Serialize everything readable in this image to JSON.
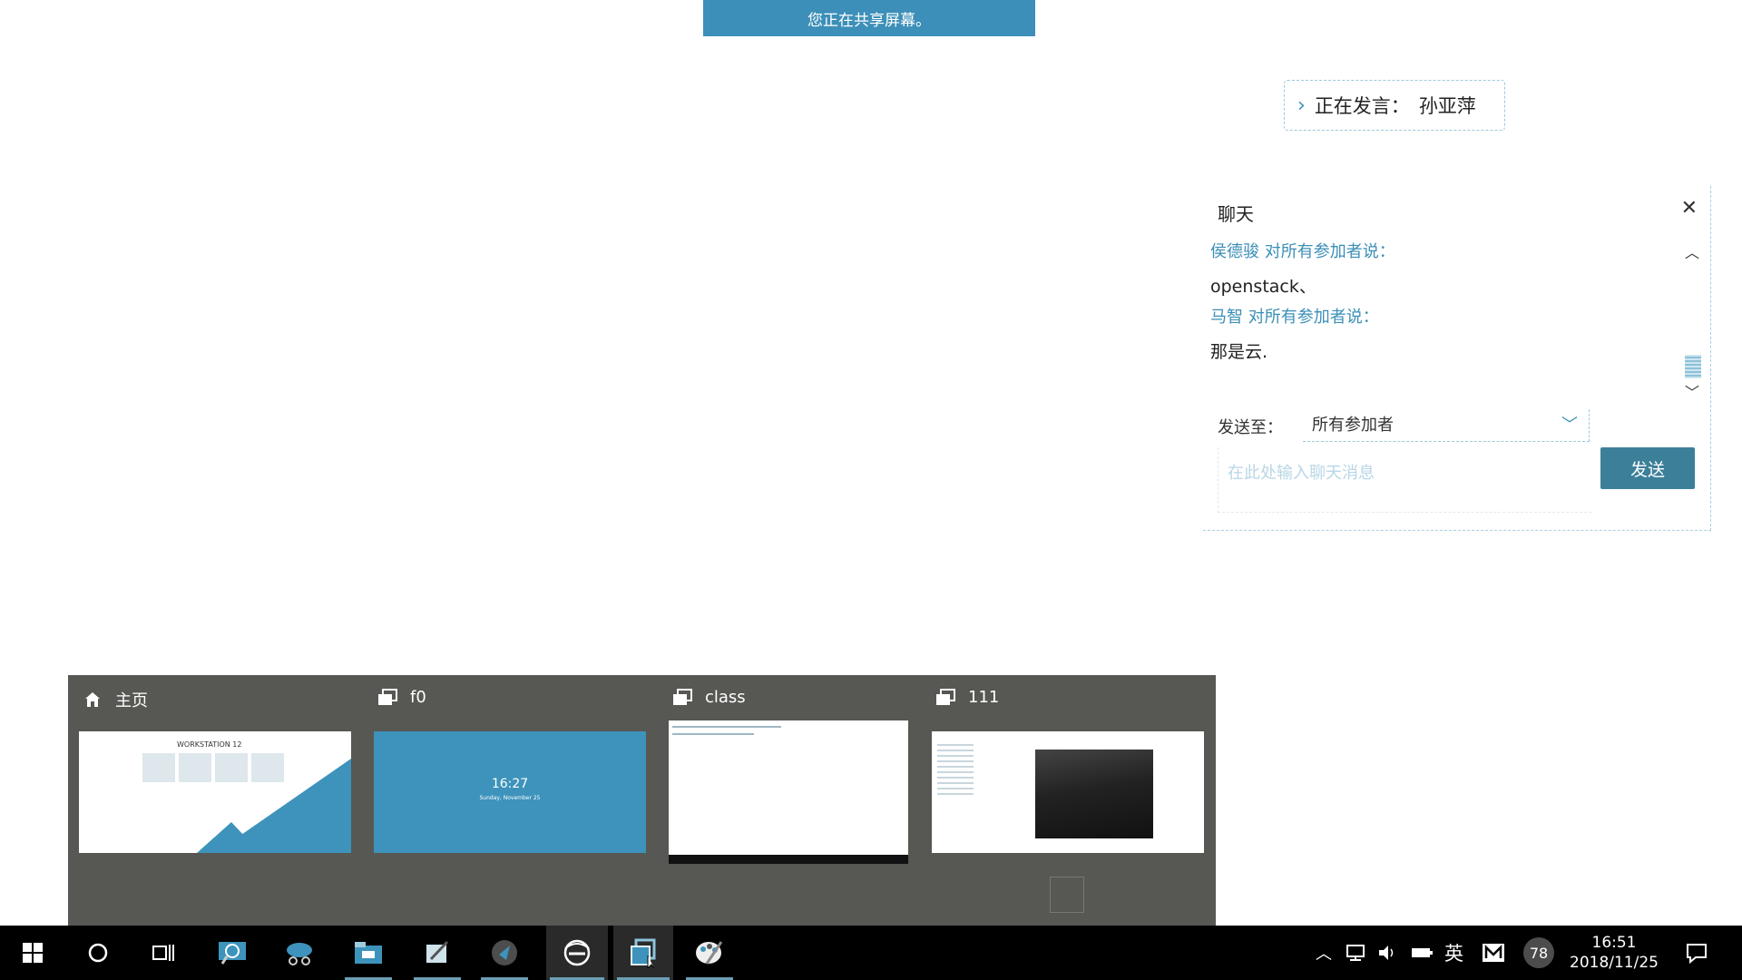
{
  "banner": {
    "text": "您正在共享屏幕。"
  },
  "speaking": {
    "label": "正在发言：",
    "name": "孙亚萍"
  },
  "chat": {
    "title": "聊天",
    "messages": [
      {
        "sender": "侯德骏 对所有参加者说：",
        "text": "openstack、"
      },
      {
        "sender": "马智 对所有参加者说：",
        "text": "那是云."
      }
    ],
    "send_to_label": "发送至：",
    "send_to_value": "所有参加者",
    "input_placeholder": "在此处输入聊天消息",
    "send_button": "发送"
  },
  "thumbnails": [
    {
      "label": "主页",
      "icon": "home-icon",
      "preview_title": "WORKSTATION 12"
    },
    {
      "label": "f0",
      "icon": "vm-icon",
      "preview_time": "16:27",
      "preview_date": "Sunday, November 25"
    },
    {
      "label": "class",
      "icon": "vm-icon"
    },
    {
      "label": "111",
      "icon": "vm-icon"
    }
  ],
  "taskbar": {
    "apps": [
      "start-icon",
      "cortana-icon",
      "task-view-icon",
      "magnifier-app-icon",
      "snipping-app-icon",
      "file-explorer-icon",
      "notepad-app-icon",
      "media-app-icon",
      "ie-browser-icon",
      "vmware-icon",
      "paint-app-icon"
    ],
    "tray": {
      "ime": "英",
      "badge": "78",
      "time": "16:51",
      "date": "2018/11/25"
    }
  },
  "colors": {
    "accent": "#3c8fb8",
    "popup_bg": "#575753",
    "taskbar_bg": "#000000"
  }
}
